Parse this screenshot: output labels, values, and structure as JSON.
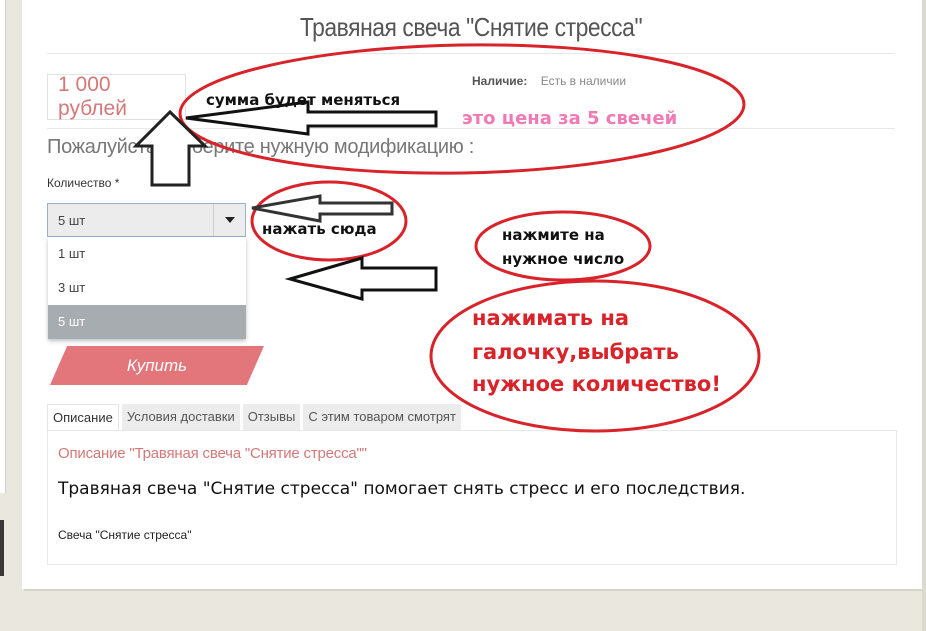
{
  "product": {
    "title": "Травяная свеча \"Снятие стресса\"",
    "price": "1 000 рублей",
    "stock_label": "Наличие:",
    "stock_value": "Есть в наличии"
  },
  "modification": {
    "heading": "Пожалуйста, выберите нужную модификацию :",
    "quantity_label": "Количество *",
    "selected": "5 шт",
    "options": [
      "1 шт",
      "3 шт",
      "5 шт"
    ],
    "active_index": 2
  },
  "buy_label": "Купить",
  "tabs": [
    {
      "label": "Описание",
      "active": true
    },
    {
      "label": "Условия доставки",
      "active": false
    },
    {
      "label": "Отзывы",
      "active": false
    },
    {
      "label": "С этим товаром смотрят",
      "active": false
    }
  ],
  "description": {
    "heading": "Описание \"Травяная свеча \"Снятие стресса\"\"",
    "main": "Травяная свеча \"Снятие стресса\" помогает снять стресс и его последствия.",
    "small": "Свеча \"Снятие стресса\""
  },
  "annotations": {
    "price_changes": "сумма будет меняться",
    "price_for_five": "это цена за 5 свечей",
    "click_here": "нажать сюда",
    "click_number_line1": "нажмите на",
    "click_number_line2": "нужное число",
    "tick_line1": "нажимать на",
    "tick_line2": "галочку,выбрать",
    "tick_line3": "нужное количество!"
  },
  "colors": {
    "accent": "#e2767b",
    "price_text": "#d47878",
    "annotation_red": "#d8232a",
    "annotation_pink": "#f07ab4",
    "background": "#e9e7de"
  }
}
